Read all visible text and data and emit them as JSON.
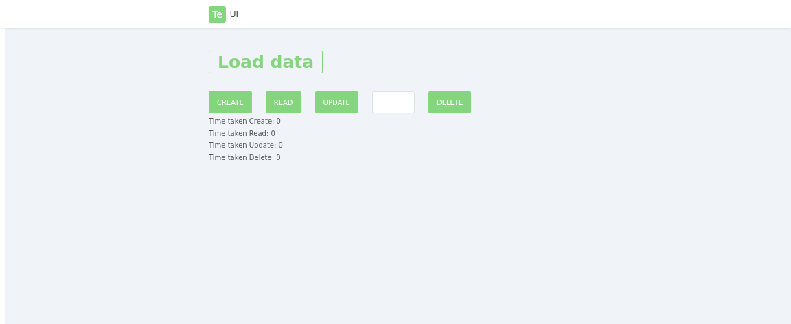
{
  "header": {
    "logo": "Te",
    "title": "UI"
  },
  "heading": "Load data",
  "controls": [
    {
      "kind": "button",
      "label": "CREATE"
    },
    {
      "kind": "button",
      "label": "READ"
    },
    {
      "kind": "button",
      "label": "UPDATE"
    },
    {
      "kind": "input"
    },
    {
      "kind": "button",
      "label": "DELETE"
    }
  ],
  "timings": [
    "Time taken Create: 0",
    "Time taken Read: 0",
    "Time taken Update: 0",
    "Time taken Delete: 0"
  ]
}
